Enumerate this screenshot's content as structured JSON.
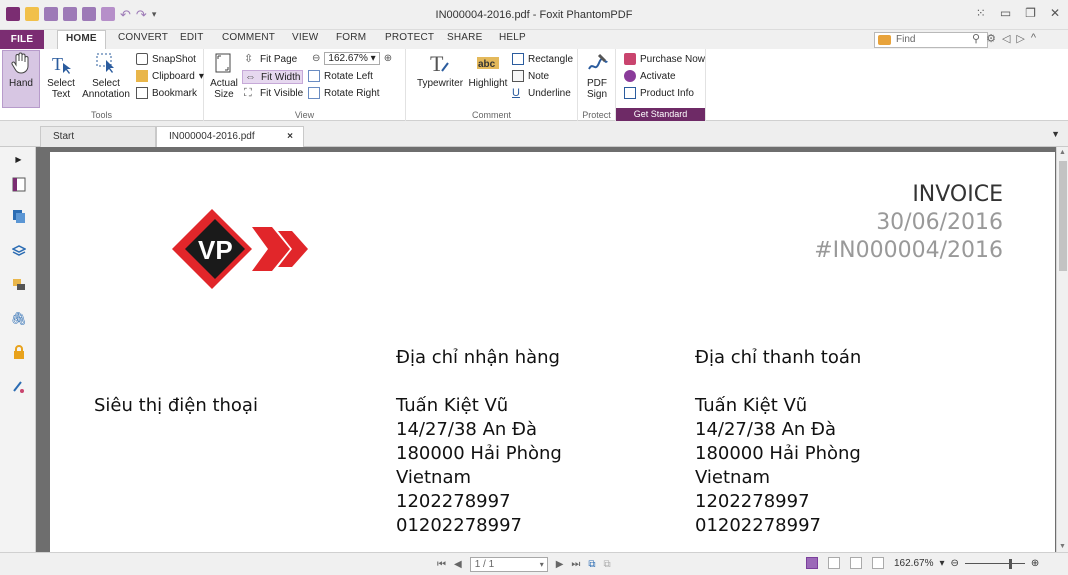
{
  "app": {
    "window_title": "IN000004-2016.pdf - Foxit PhantomPDF"
  },
  "ribbon_tabs": [
    "FILE",
    "HOME",
    "CONVERT",
    "EDIT",
    "COMMENT",
    "VIEW",
    "FORM",
    "PROTECT",
    "SHARE",
    "HELP"
  ],
  "find": {
    "placeholder": "Find"
  },
  "tools": {
    "hand": "Hand",
    "select_text_1": "Select",
    "select_text_2": "Text",
    "select_annotation_1": "Select",
    "select_annotation_2": "Annotation",
    "snapshot": "SnapShot",
    "clipboard": "Clipboard",
    "bookmark": "Bookmark",
    "label": "Tools"
  },
  "view": {
    "actual_size_1": "Actual",
    "actual_size_2": "Size",
    "fit_page": "Fit Page",
    "fit_width": "Fit Width",
    "fit_visible": "Fit Visible",
    "zoom": "162.67%",
    "rotate_left": "Rotate Left",
    "rotate_right": "Rotate Right",
    "label": "View"
  },
  "comment": {
    "typewriter": "Typewriter",
    "highlight": "Highlight",
    "rectangle": "Rectangle",
    "note": "Note",
    "underline": "Underline",
    "label": "Comment"
  },
  "protect": {
    "pdf_sign_1": "PDF",
    "pdf_sign_2": "Sign",
    "label": "Protect"
  },
  "get_standard": {
    "purchase_now": "Purchase Now",
    "activate": "Activate",
    "product_info": "Product Info",
    "label": "Get Standard"
  },
  "doc_tabs": {
    "start": "Start",
    "file": "IN000004-2016.pdf",
    "close": "×"
  },
  "document": {
    "logo_text": "VP",
    "invoice_title": "INVOICE",
    "invoice_date": "30/06/2016",
    "invoice_number": "#IN000004/2016",
    "seller": "Siêu thị điện thoại",
    "shipping": {
      "heading": "Địa chỉ nhận hàng",
      "name": "Tuấn Kiệt Vũ",
      "street": "14/27/38 An Đà",
      "city": "180000 Hải Phòng",
      "country": "Vietnam",
      "phone1": "1202278997",
      "phone2": "01202278997"
    },
    "billing": {
      "heading": "Địa chỉ thanh toán",
      "name": "Tuấn Kiệt Vũ",
      "street": "14/27/38 An Đà",
      "city": "180000 Hải Phòng",
      "country": "Vietnam",
      "phone1": "1202278997",
      "phone2": "01202278997"
    }
  },
  "status": {
    "page_indicator": "1 / 1",
    "zoom": "162.67%",
    "zoom_slider_fraction": 0.78
  },
  "colors": {
    "brand_purple": "#7b2d72",
    "logo_red": "#e1262a",
    "logo_black": "#1a1a1a"
  }
}
